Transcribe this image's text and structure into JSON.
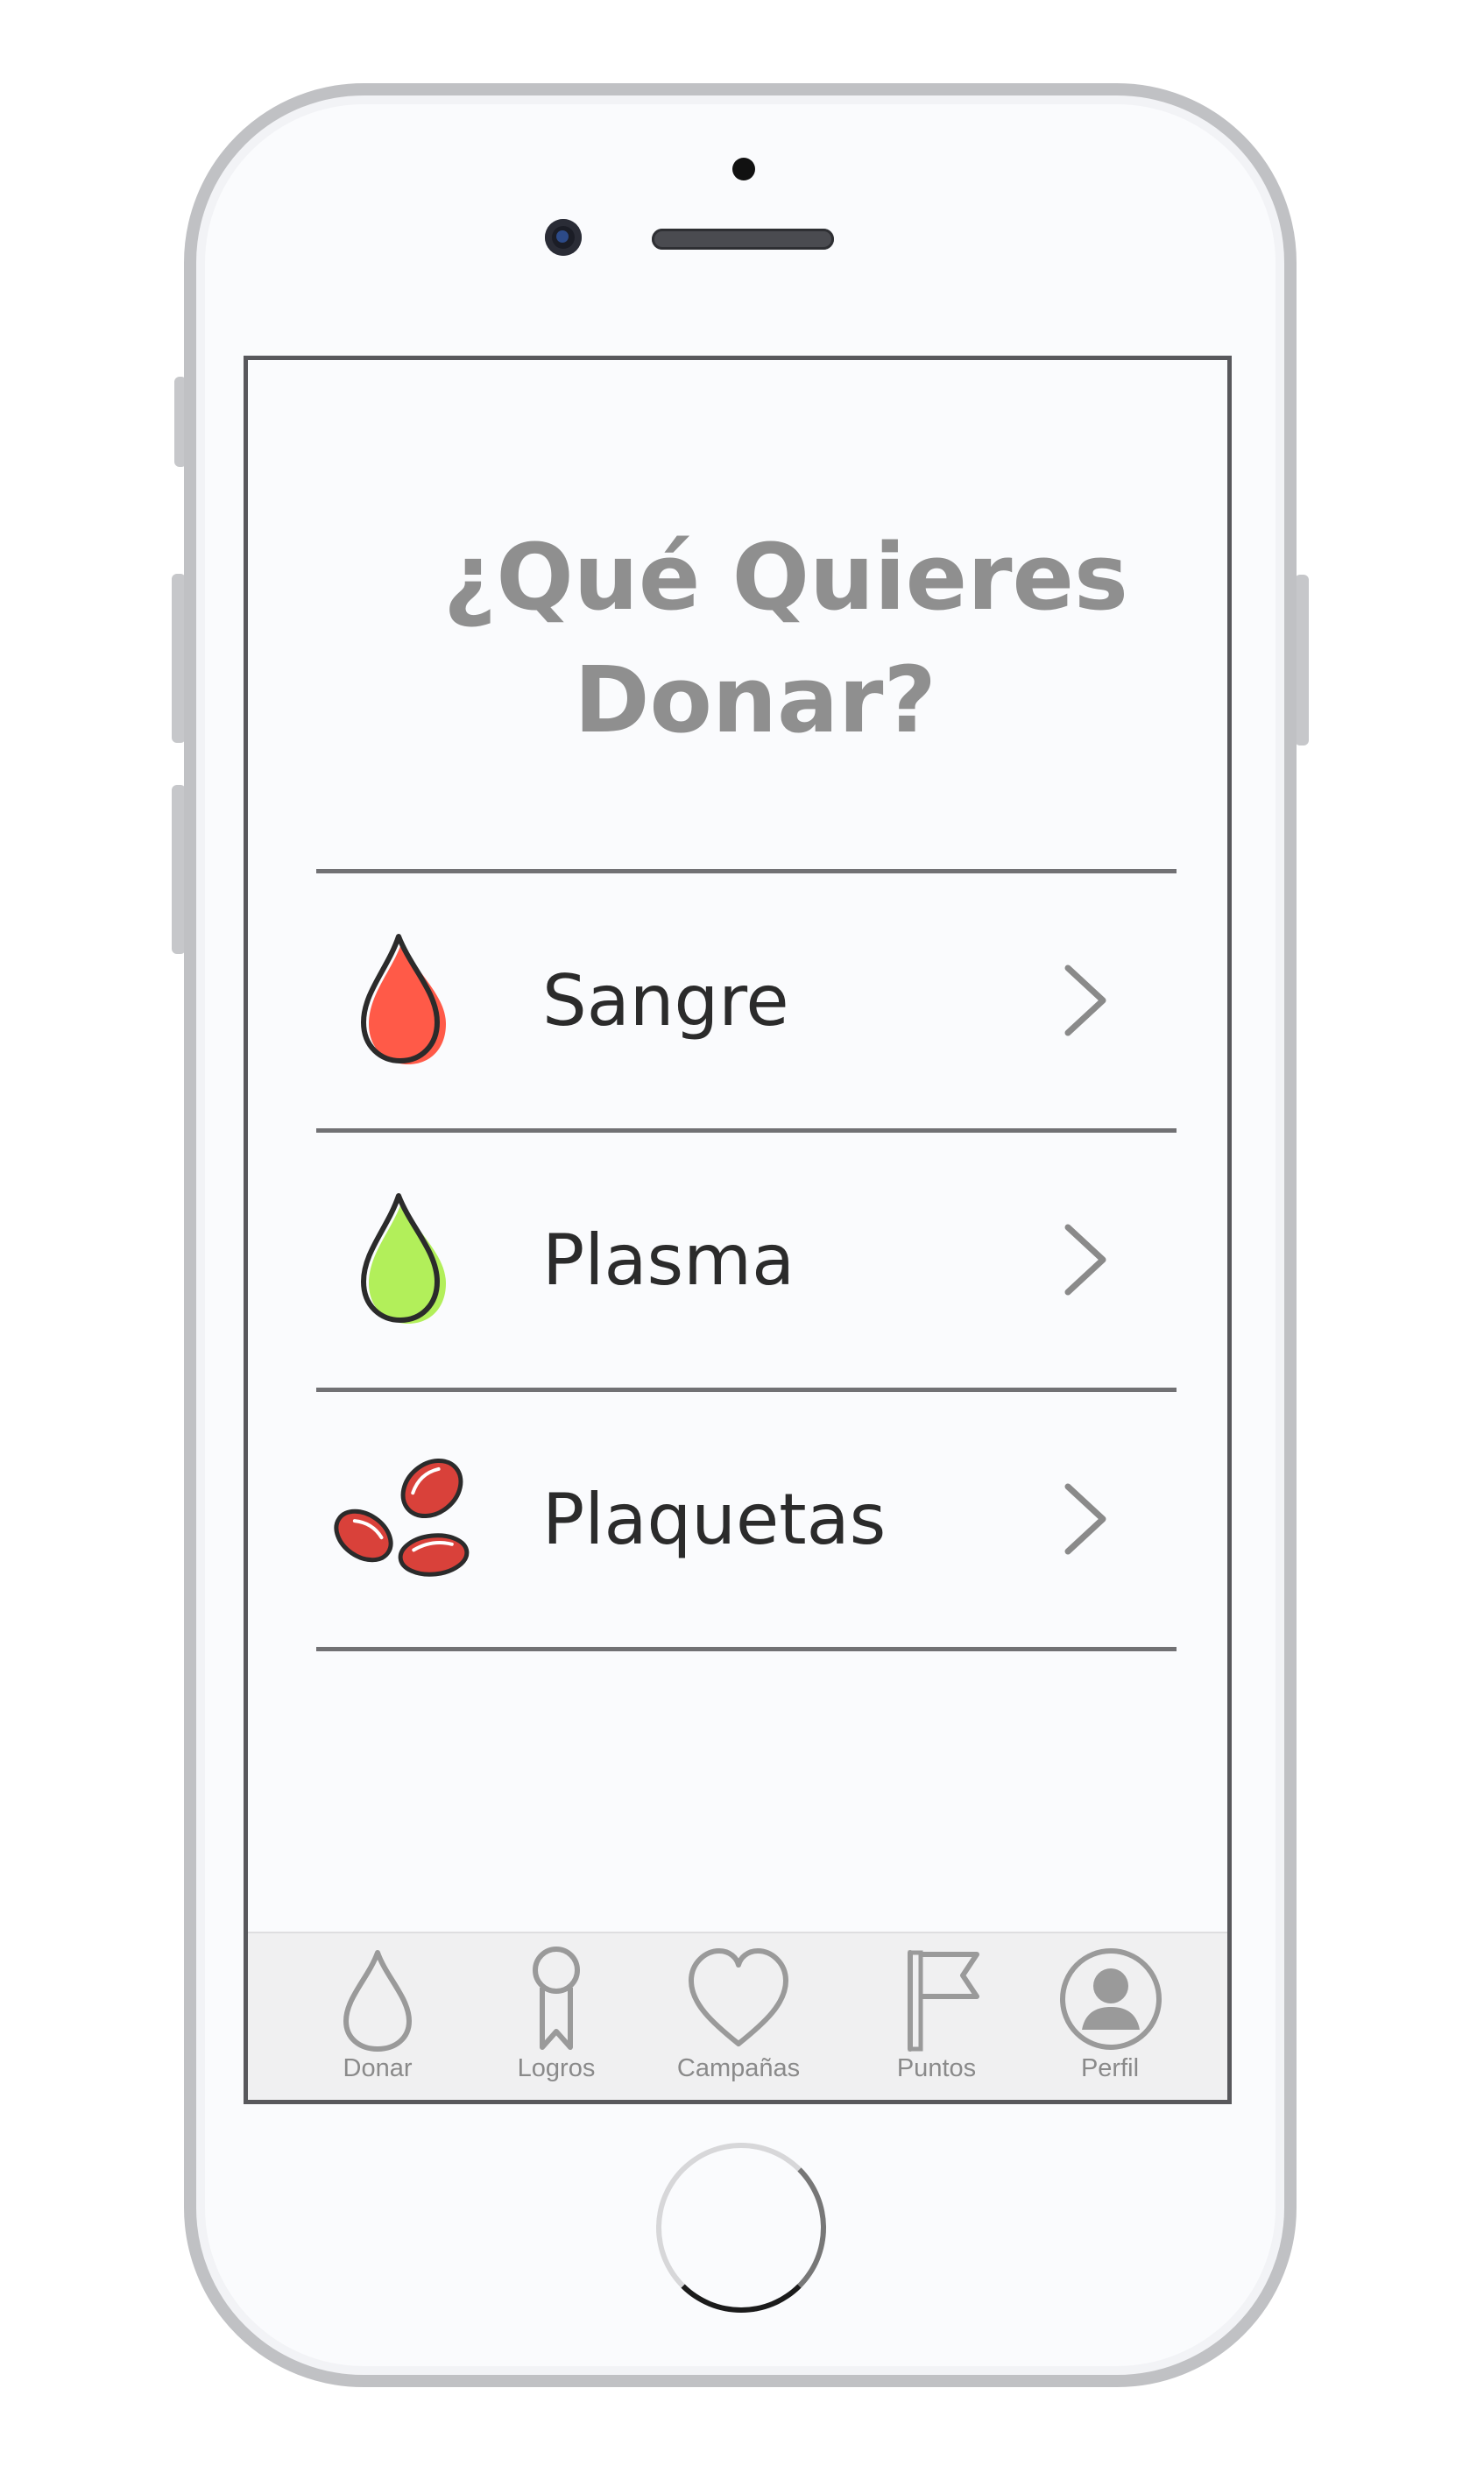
{
  "screen": {
    "title_line1": "¿Qué Quieres",
    "title_line2": "Donar?"
  },
  "options": [
    {
      "label": "Sangre",
      "icon": "blood-drop-icon",
      "color": "#ff5a48"
    },
    {
      "label": "Plasma",
      "icon": "plasma-drop-icon",
      "color": "#b2ef5a"
    },
    {
      "label": "Plaquetas",
      "icon": "platelets-icon",
      "color": "#d9413a"
    }
  ],
  "tabbar": {
    "items": [
      {
        "label": "Donar",
        "icon": "drop-icon"
      },
      {
        "label": "Logros",
        "icon": "award-ribbon-icon"
      },
      {
        "label": "Campañas",
        "icon": "heart-icon"
      },
      {
        "label": "Puntos",
        "icon": "flag-icon"
      },
      {
        "label": "Perfil",
        "icon": "user-profile-icon"
      }
    ]
  },
  "colors": {
    "title": "#8f8f8f",
    "divider": "#717174",
    "tab_icon": "#9a9a9a",
    "tabbar_bg": "#f0f0f1"
  }
}
